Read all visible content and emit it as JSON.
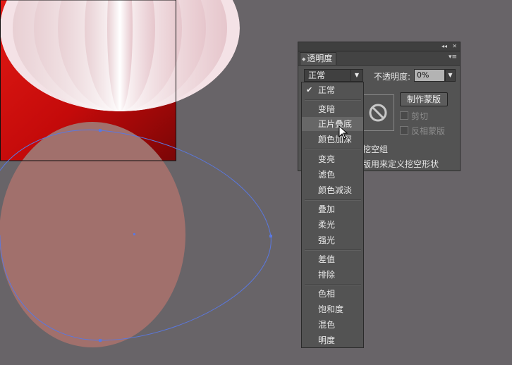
{
  "panel": {
    "tab_label": "透明度",
    "blend_mode_value": "正常",
    "opacity_label": "不透明度:",
    "opacity_value": "0%",
    "make_mask_label": "制作蒙版",
    "clip_label": "剪切",
    "invert_mask_label": "反相蒙版",
    "knockout_group_label": "挖空组",
    "define_knockout_label": "版用来定义挖空形状",
    "collapse_symbol": "◂◂",
    "close_symbol": "✕",
    "menu_symbol": "▾≡"
  },
  "dropdown": {
    "check_mark": "✔",
    "items": [
      {
        "label": "正常",
        "checked": true
      },
      {
        "label": "变暗"
      },
      {
        "label": "正片叠底",
        "hover": true
      },
      {
        "label": "颜色加深"
      },
      {
        "label": "变亮"
      },
      {
        "label": "滤色"
      },
      {
        "label": "颜色减淡"
      },
      {
        "label": "叠加"
      },
      {
        "label": "柔光"
      },
      {
        "label": "强光"
      },
      {
        "label": "差值"
      },
      {
        "label": "排除"
      },
      {
        "label": "色相"
      },
      {
        "label": "饱和度"
      },
      {
        "label": "混色"
      },
      {
        "label": "明度"
      }
    ]
  },
  "colors": {
    "workspace": "#686468",
    "artboard_red": "#d01010",
    "circle_fill": "#a1706c",
    "path_blue": "#5a78e0"
  },
  "icons": {
    "mask_thumb": "no-entry-icon",
    "pointer": "arrow-cursor-icon"
  }
}
